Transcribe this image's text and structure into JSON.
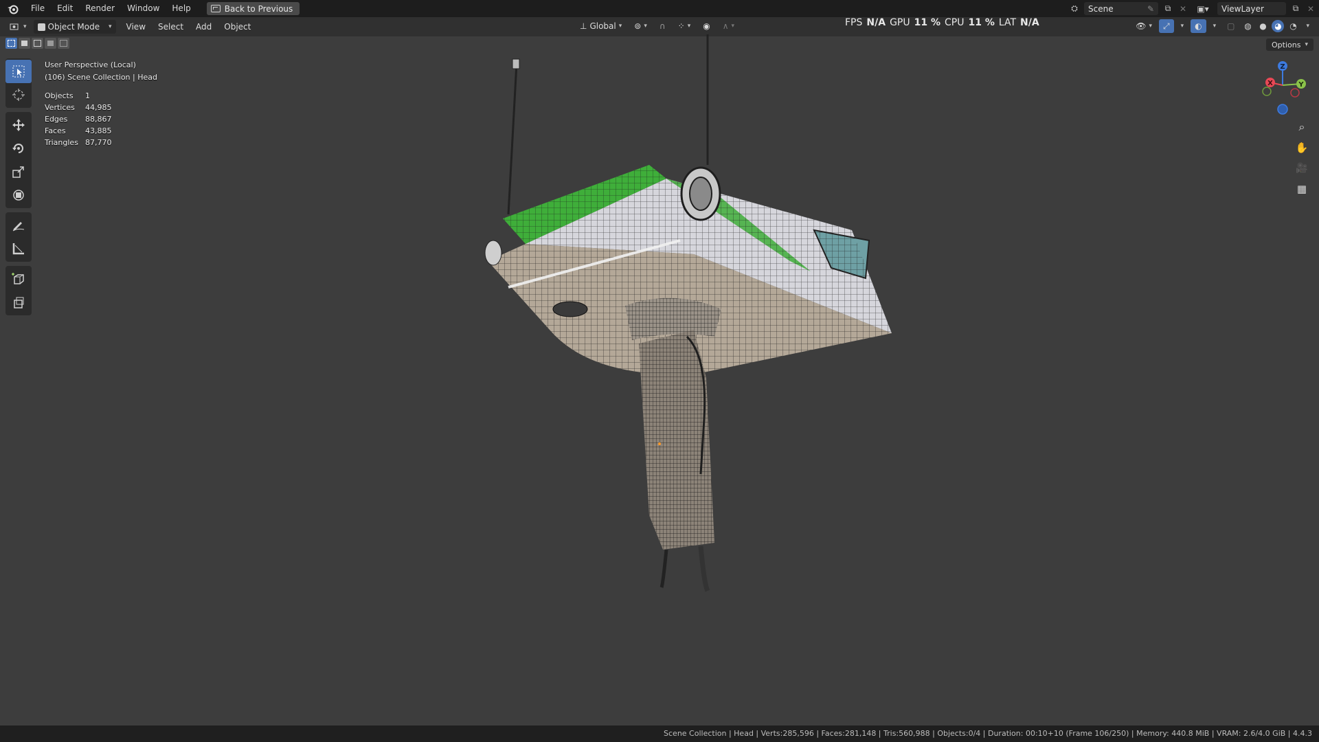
{
  "menubar": {
    "items": [
      "File",
      "Edit",
      "Render",
      "Window",
      "Help"
    ],
    "back_button": "Back to Previous",
    "scene": "Scene",
    "view_layer": "ViewLayer"
  },
  "viewport_header": {
    "mode": "Object Mode",
    "menus": [
      "View",
      "Select",
      "Add",
      "Object"
    ],
    "orientation": "Global",
    "options": "Options"
  },
  "performance": {
    "fps_label": "FPS",
    "fps_value": "N/A",
    "gpu_label": "GPU",
    "gpu_value": "11 %",
    "cpu_label": "CPU",
    "cpu_value": "11 %",
    "lat_label": "LAT",
    "lat_value": "N/A"
  },
  "overlay": {
    "view_name": "User Perspective (Local)",
    "collection": "(106) Scene Collection | Head"
  },
  "stats": [
    {
      "label": "Objects",
      "value": "1"
    },
    {
      "label": "Vertices",
      "value": "44,985"
    },
    {
      "label": "Edges",
      "value": "88,867"
    },
    {
      "label": "Faces",
      "value": "43,885"
    },
    {
      "label": "Triangles",
      "value": "87,770"
    }
  ],
  "gizmo": {
    "x": "X",
    "y": "Y",
    "z": "Z"
  },
  "status_bar": "Scene Collection | Head | Verts:285,596 | Faces:281,148 | Tris:560,988 | Objects:0/4 | Duration: 00:10+10 (Frame 106/250) | Memory: 440.8 MiB | VRAM: 2.6/4.0 GiB | 4.4.3",
  "colors": {
    "accent": "#4772b3",
    "x_axis": "#e84855",
    "y_axis": "#8bc34a",
    "z_axis": "#3d7be0",
    "model_stripe": "#3fae3a"
  }
}
